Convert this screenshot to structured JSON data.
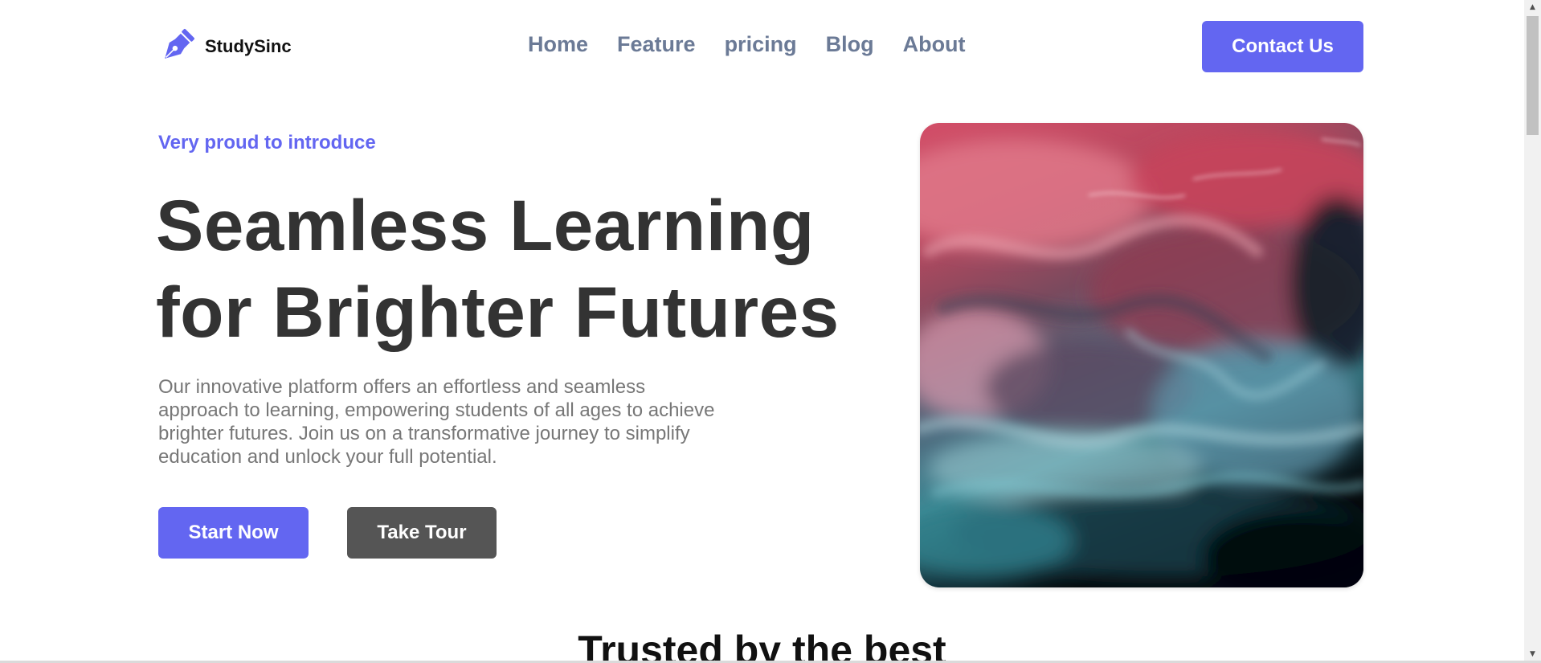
{
  "brand": {
    "name": "StudySinc",
    "icon": "pen-nib-icon",
    "color": "#6366f1"
  },
  "nav": {
    "items": [
      {
        "label": "Home"
      },
      {
        "label": "Feature"
      },
      {
        "label": "pricing"
      },
      {
        "label": "Blog"
      },
      {
        "label": "About"
      }
    ],
    "color": "#6b7a96"
  },
  "header": {
    "contact_label": "Contact Us"
  },
  "hero": {
    "eyebrow": "Very proud to introduce",
    "headline_line1": "Seamless Learning",
    "headline_line2": "for Brighter Futures",
    "description": "Our innovative platform offers an effortless and seamless approach to learning, empowering students of all ages to achieve brighter futures. Join us on a transformative journey to simplify education and unlock your full potential.",
    "primary_cta": "Start Now",
    "secondary_cta": "Take Tour",
    "image": "abstract-fluid-art-image"
  },
  "trusted": {
    "title": "Trusted by the best"
  },
  "colors": {
    "accent": "#6366f1",
    "dark_button": "#555555",
    "heading": "#333333",
    "body_text": "#777777"
  }
}
